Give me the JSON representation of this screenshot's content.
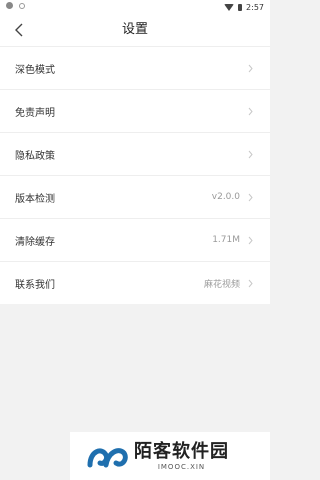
{
  "status_bar": {
    "time": "2:57"
  },
  "header": {
    "title": "设置"
  },
  "settings": {
    "items": [
      {
        "label": "深色模式",
        "value": ""
      },
      {
        "label": "免责声明",
        "value": ""
      },
      {
        "label": "隐私政策",
        "value": ""
      },
      {
        "label": "版本检测",
        "value": "v2.0.0"
      },
      {
        "label": "清除缓存",
        "value": "1.71M"
      },
      {
        "label": "联系我们",
        "value": "麻花视频"
      }
    ]
  },
  "watermark": {
    "brand": "陌客软件园",
    "domain": "IMOOC.XIN",
    "color": "#1f6fae"
  }
}
